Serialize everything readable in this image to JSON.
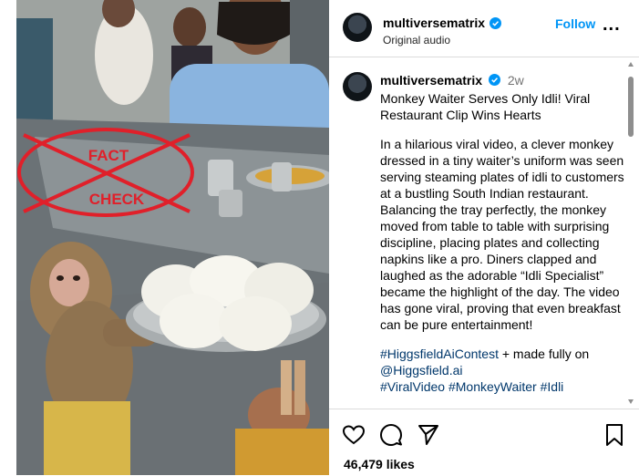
{
  "media": {
    "fact_check_top": "FACT",
    "fact_check_bottom": "CHECK"
  },
  "header": {
    "username": "multiversematrix",
    "audio": "Original audio",
    "follow_label": "Follow",
    "more_label": "..."
  },
  "caption": {
    "username": "multiversematrix",
    "time": "2w",
    "title": "Monkey Waiter Serves Only Idli! Viral Restaurant Clip Wins Hearts",
    "body": "In a hilarious viral video, a clever monkey dressed in a tiny waiter’s uniform was seen serving steaming plates of idli to customers at a bustling South Indian restaurant. Balancing the tray perfectly, the monkey moved from table to table with surprising discipline, placing plates and collecting napkins like a pro. Diners clapped and laughed as the adorable “Idli Specialist” became the highlight of the day. The video has gone viral, proving that even breakfast can be pure entertainment!",
    "hashtag": "#HiggsfieldAiContest",
    "tail_text": " + made fully on",
    "mention": "@Higgsfield.ai",
    "cut_line": "#ViralVideo #MonkeyWaiter #Idli"
  },
  "footer": {
    "likes": "46,479 likes"
  },
  "icons": {
    "like": "heart-icon",
    "comment": "comment-icon",
    "share": "send-icon",
    "save": "bookmark-icon",
    "verified": "verified-badge-icon"
  },
  "colors": {
    "link": "#0095f6",
    "fact_check": "#e0202a",
    "verified": "#0095f6"
  }
}
